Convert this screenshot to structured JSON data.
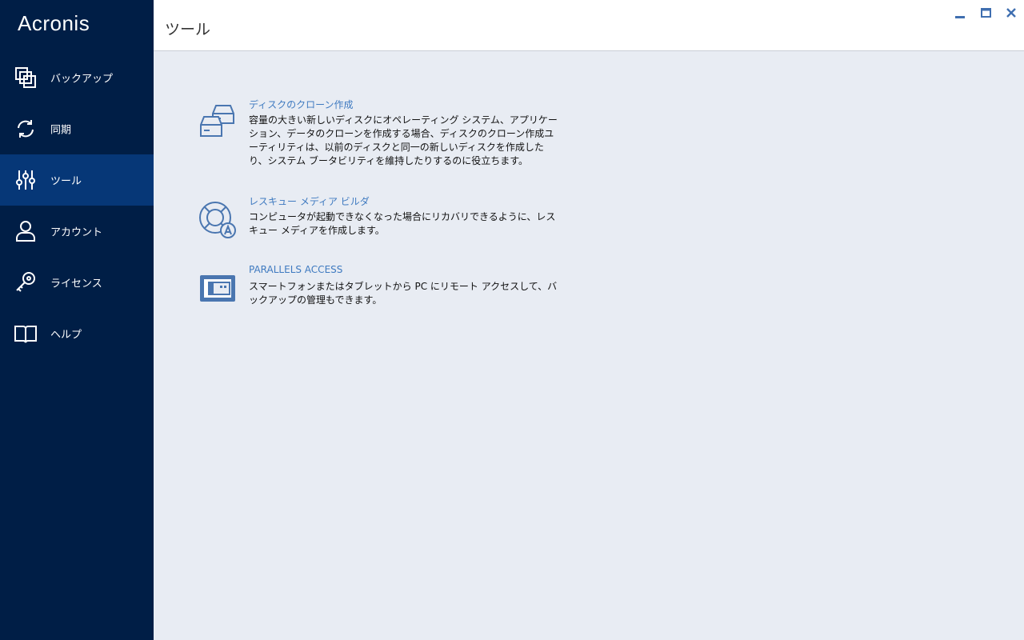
{
  "app": {
    "logo_text": "Acronis"
  },
  "sidebar": {
    "items": [
      {
        "label": "バックアップ",
        "icon": "backup-icon",
        "active": false
      },
      {
        "label": "同期",
        "icon": "sync-icon",
        "active": false
      },
      {
        "label": "ツール",
        "icon": "tools-icon",
        "active": true
      },
      {
        "label": "アカウント",
        "icon": "account-icon",
        "active": false
      },
      {
        "label": "ライセンス",
        "icon": "key-icon",
        "active": false
      },
      {
        "label": "ヘルプ",
        "icon": "book-icon",
        "active": false
      }
    ]
  },
  "header": {
    "title": "ツール",
    "window_controls": [
      "minimize-icon",
      "maximize-icon",
      "close-icon"
    ]
  },
  "tools": [
    {
      "title": "ディスクのクローン作成",
      "description": "容量の大きい新しいディスクにオペレーティング システム、アプリケーション、データのクローンを作成する場合、ディスクのクローン作成ユーティリティは、以前のディスクと同一の新しいディスクを作成したり、システム ブータビリティを維持したりするのに役立ちます。",
      "icon": "disk-clone-icon"
    },
    {
      "title": "レスキュー メディア ビルダ",
      "description": "コンピュータが起動できなくなった場合にリカバリできるように、レスキュー メディアを作成します。",
      "icon": "rescue-lifebuoy-icon"
    },
    {
      "title": "PARALLELS ACCESS",
      "description": "スマートフォンまたはタブレットから PC にリモート アクセスして、バックアップの管理もできます。",
      "icon": "tablet-icon"
    }
  ],
  "colors": {
    "sidebar_bg": "#001e46",
    "sidebar_active": "#063777",
    "content_bg": "#e8ecf3",
    "link": "#3f7ac0",
    "icon_blue": "#4a76b0"
  }
}
